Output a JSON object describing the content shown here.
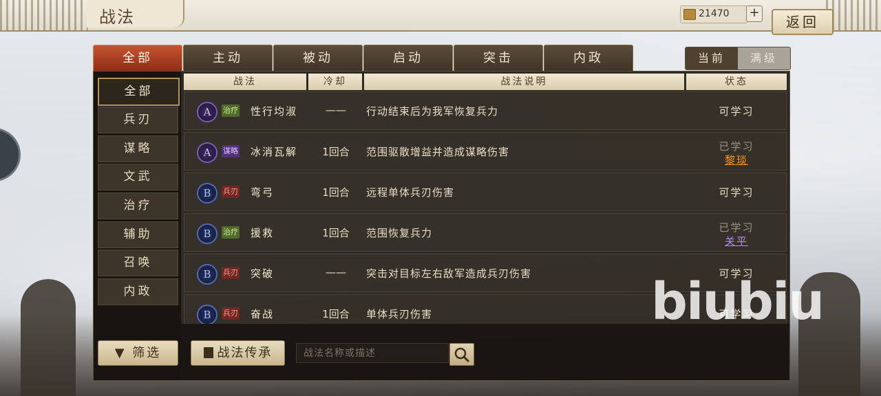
{
  "header": {
    "title": "战法",
    "currency": "21470",
    "plus": "+",
    "back": "返回"
  },
  "tabs": [
    "全部",
    "主动",
    "被动",
    "启动",
    "突击",
    "内政"
  ],
  "level_toggle": {
    "current": "当前",
    "max": "满级"
  },
  "sidebar": {
    "items": [
      "全部",
      "兵刃",
      "谋略",
      "文武",
      "治疗",
      "辅助",
      "召唤",
      "内政"
    ],
    "filter_label": "筛选"
  },
  "table": {
    "headers": {
      "skill": "战法",
      "cooldown": "冷却",
      "description": "战法说明",
      "status": "状态"
    },
    "rows": [
      {
        "grade": "A",
        "tag": "治疗",
        "name": "性行均淑",
        "cooldown": "——",
        "description": "行动结束后为我军恢复兵力",
        "status": "可学习",
        "learner": ""
      },
      {
        "grade": "A",
        "tag": "谋略",
        "name": "冰消瓦解",
        "cooldown": "1回合",
        "description": "范围驱散增益并造成谋略伤害",
        "status": "已学习",
        "learner": "黎琰"
      },
      {
        "grade": "B",
        "tag": "兵刃",
        "name": "弯弓",
        "cooldown": "1回合",
        "description": "远程单体兵刃伤害",
        "status": "可学习",
        "learner": ""
      },
      {
        "grade": "B",
        "tag": "治疗",
        "name": "援救",
        "cooldown": "1回合",
        "description": "范围恢复兵力",
        "status": "已学习",
        "learner": "关平"
      },
      {
        "grade": "B",
        "tag": "兵刃",
        "name": "突破",
        "cooldown": "——",
        "description": "突击对目标左右敌军造成兵刃伤害",
        "status": "可学习",
        "learner": ""
      },
      {
        "grade": "B",
        "tag": "兵刃",
        "name": "奋战",
        "cooldown": "1回合",
        "description": "单体兵刃伤害",
        "status": "可学习",
        "learner": ""
      }
    ]
  },
  "bottom": {
    "inherit_label": "战法传承",
    "search_placeholder": "战法名称或描述"
  },
  "watermark": "biubiu",
  "colors": {
    "accent_tab": "#b04526",
    "learner_orange": "#ff9a1f",
    "learner_purple": "#b98aff"
  }
}
